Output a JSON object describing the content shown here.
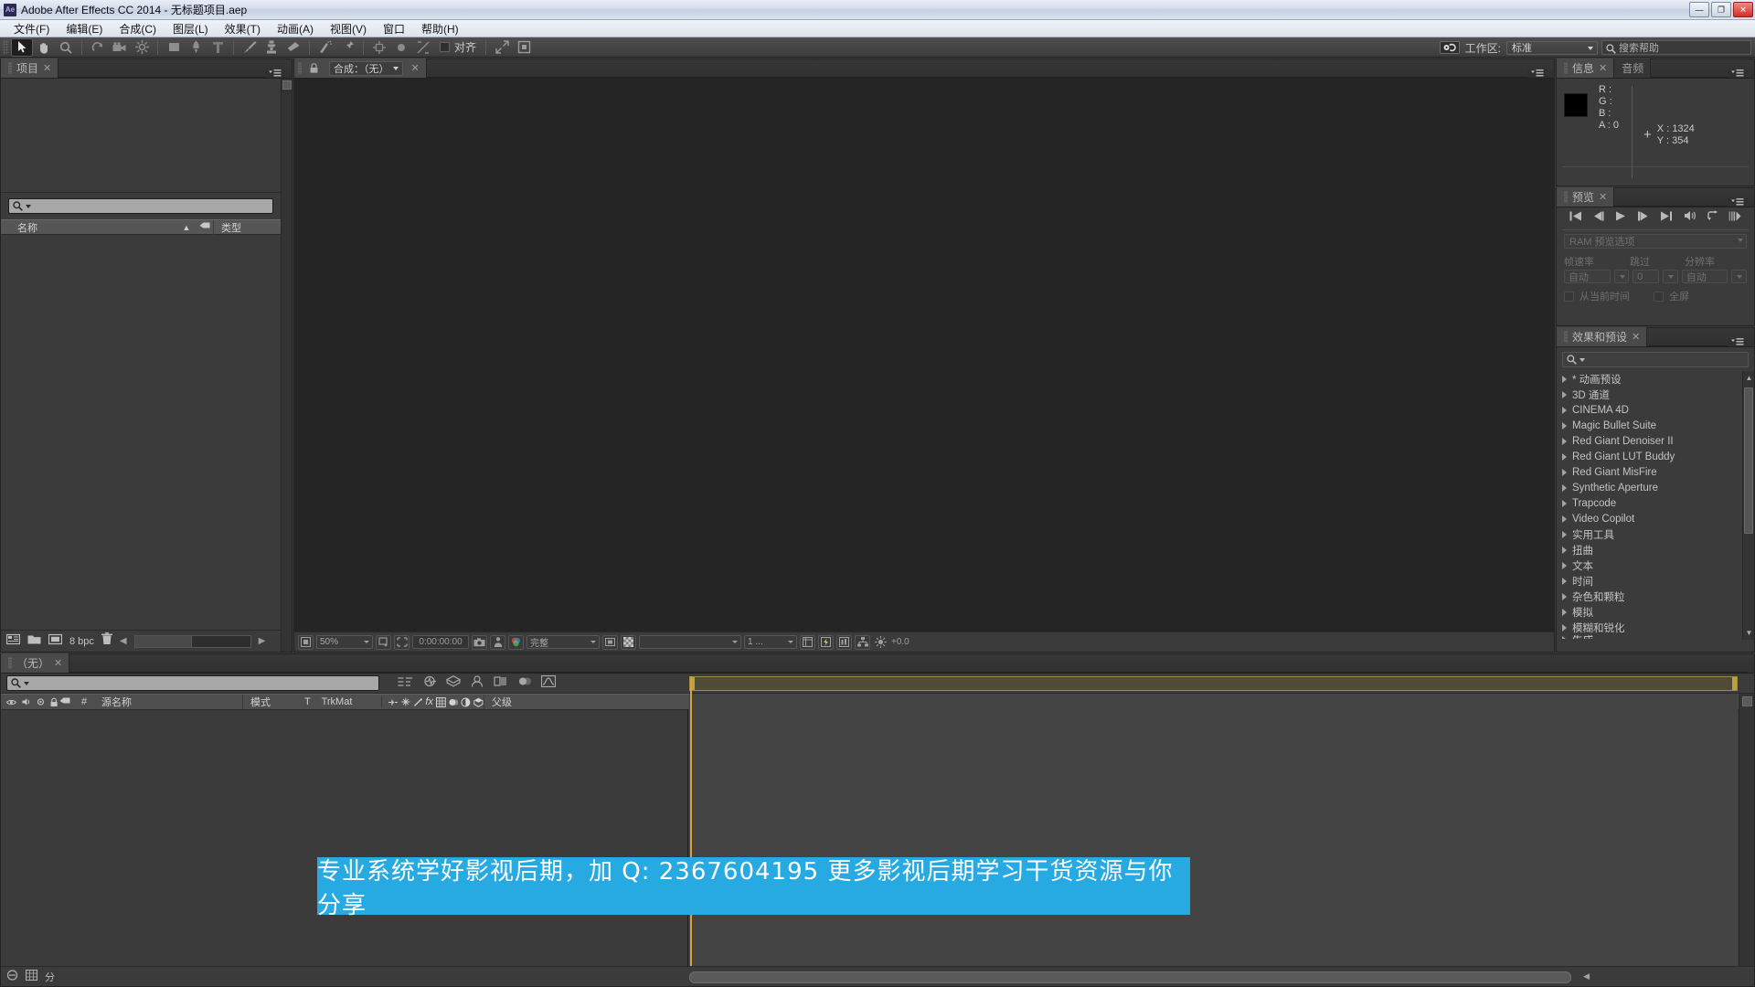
{
  "window": {
    "app_icon": "Ae",
    "title": "Adobe After Effects CC 2014 - 无标题项目.aep",
    "minimize_glyph": "—",
    "maximize_glyph": "❐",
    "close_glyph": "✕"
  },
  "menubar": {
    "items": [
      {
        "label": "文件(F)"
      },
      {
        "label": "编辑(E)"
      },
      {
        "label": "合成(C)"
      },
      {
        "label": "图层(L)"
      },
      {
        "label": "效果(T)"
      },
      {
        "label": "动画(A)"
      },
      {
        "label": "视图(V)"
      },
      {
        "label": "窗口"
      },
      {
        "label": "帮助(H)"
      }
    ]
  },
  "toolbar": {
    "align_label": "对齐",
    "workspace_label": "工作区:",
    "workspace_value": "标准",
    "search_help_placeholder": "搜索帮助",
    "tools": [
      {
        "name": "selection-tool",
        "active": true
      },
      {
        "name": "hand-tool",
        "active": false
      },
      {
        "name": "zoom-tool",
        "active": false
      },
      {
        "name": "rotation-tool",
        "active": false
      },
      {
        "name": "camera-tool",
        "active": false
      },
      {
        "name": "pan-behind-tool",
        "active": false
      },
      {
        "name": "shape-tool",
        "active": false
      },
      {
        "name": "pen-tool",
        "active": false
      },
      {
        "name": "type-tool",
        "active": false
      },
      {
        "name": "brush-tool",
        "active": false
      },
      {
        "name": "clone-stamp-tool",
        "active": false
      },
      {
        "name": "eraser-tool",
        "active": false
      },
      {
        "name": "roto-brush-tool",
        "active": false
      },
      {
        "name": "puppet-pin-tool",
        "active": false
      }
    ]
  },
  "project_panel": {
    "tab_label": "项目",
    "close_glyph": "✕",
    "search_placeholder": "",
    "columns": [
      {
        "label": "名称"
      },
      {
        "label": "类型"
      }
    ],
    "sort_arrow": "▲",
    "items": [],
    "footer": {
      "bit_depth": "8 bpc",
      "left_arrow": "◀",
      "right_arrow": "▶"
    }
  },
  "composition_panel": {
    "tab_label": "合成：（无）",
    "close_glyph": "✕",
    "footer": {
      "zoom_value": "50%",
      "timecode": "0:00:00:00",
      "resolution_value": "完整",
      "view_value": "",
      "views_value": "1 ...",
      "exposure_value": "+0.0"
    }
  },
  "info_panel": {
    "tabs": [
      {
        "label": "信息",
        "active": true,
        "close_glyph": "✕"
      },
      {
        "label": "音频",
        "active": false
      }
    ],
    "channels": [
      {
        "label": "R :",
        "value": ""
      },
      {
        "label": "G :",
        "value": ""
      },
      {
        "label": "B :",
        "value": ""
      },
      {
        "label": "A :",
        "value": "0"
      }
    ],
    "coords": [
      {
        "label": "X :",
        "value": "1324"
      },
      {
        "label": "Y :",
        "value": "354"
      }
    ],
    "crosshair_glyph": "+"
  },
  "preview_panel": {
    "tab_label": "预览",
    "close_glyph": "✕",
    "transport": [
      {
        "name": "first-frame-button",
        "glyph": "|◀"
      },
      {
        "name": "previous-frame-button",
        "glyph": "◀|"
      },
      {
        "name": "play-button",
        "glyph": "▶"
      },
      {
        "name": "next-frame-button",
        "glyph": "|▶"
      },
      {
        "name": "last-frame-button",
        "glyph": "▶|"
      },
      {
        "name": "audio-button",
        "glyph": "◀))"
      },
      {
        "name": "loop-button",
        "glyph": "↻"
      },
      {
        "name": "ram-preview-button",
        "glyph": "|||▶"
      }
    ],
    "ram_options_label": "RAM 预览选项",
    "fields": [
      {
        "label": "帧速率",
        "value": "自动"
      },
      {
        "label": "跳过",
        "value": "0"
      },
      {
        "label": "分辨率",
        "value": "自动"
      }
    ],
    "checkboxes": [
      {
        "label": "从当前时间",
        "checked": false
      },
      {
        "label": "全屏",
        "checked": false
      }
    ]
  },
  "effects_panel": {
    "tab_label": "效果和预设",
    "close_glyph": "✕",
    "search_placeholder": "",
    "items": [
      {
        "label": "* 动画预设"
      },
      {
        "label": "3D 通道"
      },
      {
        "label": "CINEMA 4D"
      },
      {
        "label": "Magic Bullet Suite"
      },
      {
        "label": "Red Giant Denoiser II"
      },
      {
        "label": "Red Giant LUT Buddy"
      },
      {
        "label": "Red Giant MisFire"
      },
      {
        "label": "Synthetic Aperture"
      },
      {
        "label": "Trapcode"
      },
      {
        "label": "Video Copilot"
      },
      {
        "label": "实用工具"
      },
      {
        "label": "扭曲"
      },
      {
        "label": "文本"
      },
      {
        "label": "时间"
      },
      {
        "label": "杂色和颗粒"
      },
      {
        "label": "模拟"
      },
      {
        "label": "模糊和锐化"
      },
      {
        "label": "生成"
      }
    ],
    "scroll_up_glyph": "▲",
    "scroll_down_glyph": "▼"
  },
  "timeline_panel": {
    "tab_label": "（无）",
    "close_glyph": "✕",
    "search_placeholder": "",
    "columns": [
      {
        "label": "#"
      },
      {
        "label": "源名称"
      },
      {
        "label": "模式"
      },
      {
        "label": "T"
      },
      {
        "label": "TrkMat"
      },
      {
        "label": "父级"
      }
    ],
    "rows": [],
    "footer": {
      "toggle_switches_glyph": "⊙",
      "graph_editor_glyph": "▦",
      "frame_label": "分"
    }
  },
  "watermark": {
    "text": "专业系统学好影视后期，加 Q: 2367604195 更多影视后期学习干货资源与你分享",
    "background_color": "#27a9e1",
    "text_color": "#ffffff"
  },
  "colors": {
    "panel_bg": "#3b3b3b",
    "viewer_bg": "#252525",
    "accent": "#27a9e1",
    "workbar": "#b8a247"
  }
}
